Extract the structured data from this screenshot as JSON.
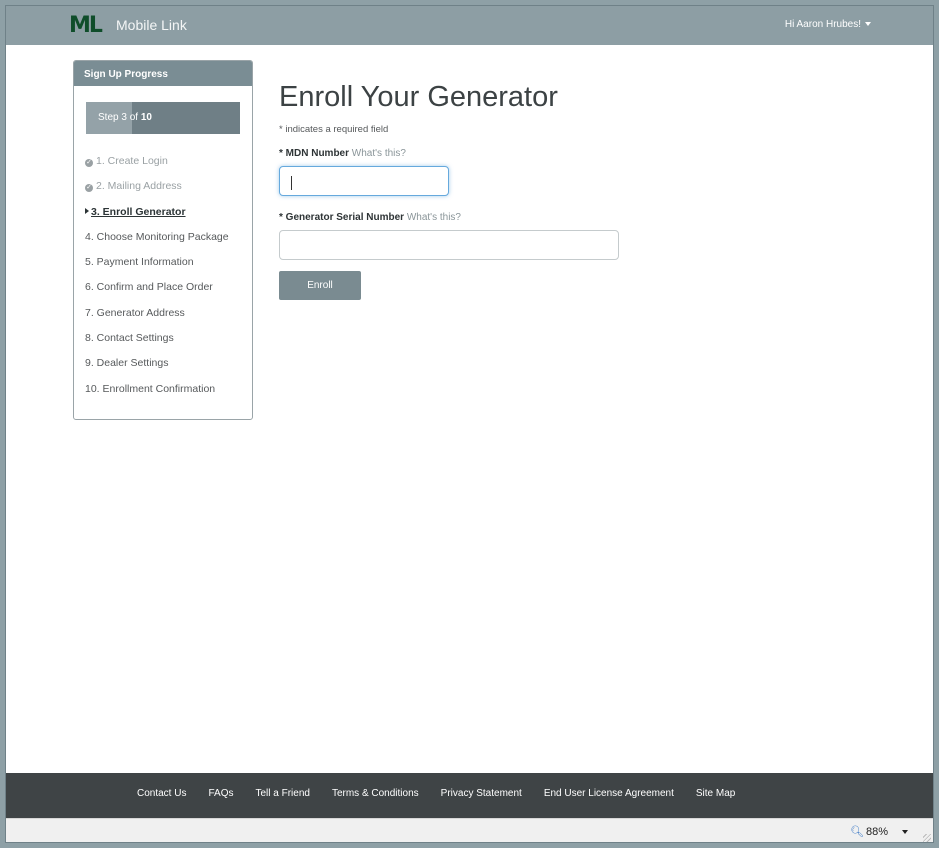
{
  "header": {
    "logo_letters": "ML",
    "brand_name": "Mobile Link",
    "user_greeting": "Hi Aaron Hrubes!"
  },
  "sidebar": {
    "title": "Sign Up Progress",
    "step_prefix": "Step 3 of ",
    "step_total": "10",
    "step_progress_fraction": 0.3,
    "steps": [
      {
        "label": "1. Create Login",
        "state": "done"
      },
      {
        "label": "2. Mailing Address",
        "state": "done"
      },
      {
        "label": "3. Enroll Generator",
        "state": "current"
      },
      {
        "label": "4. Choose Monitoring Package",
        "state": "pending"
      },
      {
        "label": "5. Payment Information",
        "state": "pending"
      },
      {
        "label": "6. Confirm and Place Order",
        "state": "pending"
      },
      {
        "label": "7. Generator Address",
        "state": "pending"
      },
      {
        "label": "8. Contact Settings",
        "state": "pending"
      },
      {
        "label": "9. Dealer Settings",
        "state": "pending"
      },
      {
        "label": "10. Enrollment Confirmation",
        "state": "pending"
      }
    ]
  },
  "main": {
    "title": "Enroll Your Generator",
    "required_note": "* indicates a required field",
    "mdn": {
      "label": "* MDN Number",
      "help": "What's this?",
      "value": ""
    },
    "serial": {
      "label": "* Generator Serial Number",
      "help": "What's this?",
      "value": ""
    },
    "submit_label": "Enroll"
  },
  "footer": {
    "links": [
      "Contact Us",
      "FAQs",
      "Tell a Friend",
      "Terms & Conditions",
      "Privacy Statement",
      "End User License Agreement",
      "Site Map"
    ]
  },
  "statusbar": {
    "zoom": "88%"
  },
  "colors": {
    "nav": "#8d9ea4",
    "footer": "#3f4446",
    "button": "#7a8b91",
    "focus": "#66a9dd"
  }
}
